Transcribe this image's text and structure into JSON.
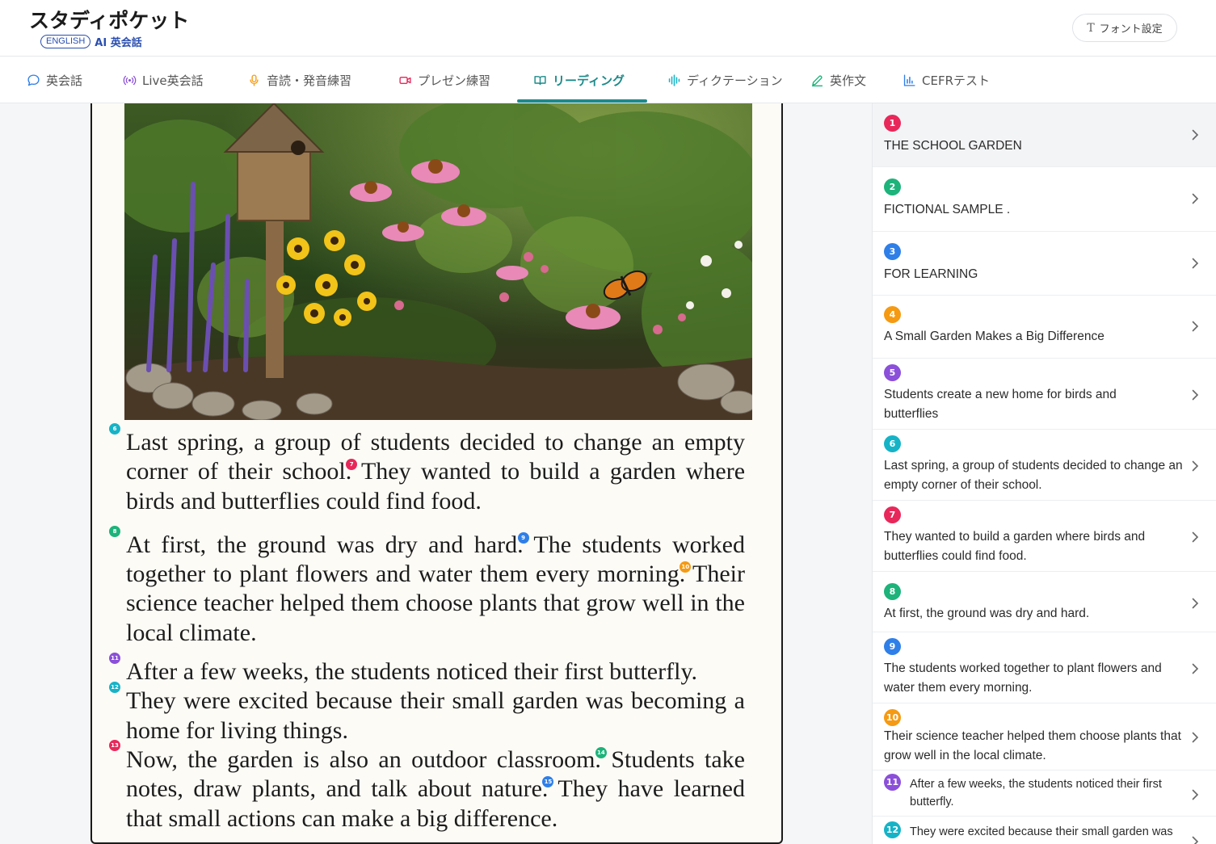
{
  "header": {
    "app_title": "スタディポケット",
    "badge": "ENGLISH",
    "subtitle": "AI 英会話",
    "font_settings": "フォント設定"
  },
  "nav": {
    "tabs": [
      {
        "label": "英会話",
        "icon": "chat-bubble-icon"
      },
      {
        "label": "Live英会話",
        "icon": "broadcast-icon"
      },
      {
        "label": "音読・発音練習",
        "icon": "microphone-icon"
      },
      {
        "label": "プレゼン練習",
        "icon": "video-camera-icon"
      },
      {
        "label": "リーディング",
        "icon": "open-book-icon",
        "active": true
      },
      {
        "label": "ディクテーション",
        "icon": "sound-wave-icon"
      },
      {
        "label": "英作文",
        "icon": "pencil-icon"
      },
      {
        "label": "CEFRテスト",
        "icon": "bar-chart-icon"
      }
    ]
  },
  "article": {
    "image": "garden-photo",
    "sentences": [
      "Last spring, a group of students decided to change an empty corner of their school.",
      "They wanted to build a garden where birds and butterflies could find food.",
      "At first, the ground was dry and hard.",
      "The students worked together to plant flowers and water them every morning.",
      "Their science teacher helped them choose plants that grow well in the local climate.",
      "After a few weeks, the students noticed their first butterfly.",
      "They were excited because their small garden was becoming a home for living things.",
      "Now, the garden is also an outdoor classroom.",
      "Students take notes, draw plants, and talk about nature.",
      "They have learned that small actions can make a big difference."
    ],
    "markers": [
      "6",
      "7",
      "8",
      "9",
      "10",
      "11",
      "12",
      "13",
      "14",
      "15"
    ]
  },
  "sidebar": {
    "items": [
      {
        "num": "1",
        "text": "THE SCHOOL GARDEN",
        "color": "#e8285a"
      },
      {
        "num": "2",
        "text": "FICTIONAL SAMPLE .",
        "color": "#1db37a"
      },
      {
        "num": "3",
        "text": "FOR LEARNING",
        "color": "#2f7fe8"
      },
      {
        "num": "4",
        "text": "A Small Garden Makes a Big Difference",
        "color": "#f59a12"
      },
      {
        "num": "5",
        "text": "Students create a new home for birds and butterflies",
        "color": "#8b4fd9"
      },
      {
        "num": "6",
        "text": "Last spring, a group of students decided to change an empty corner of their school.",
        "color": "#16b3c7"
      },
      {
        "num": "7",
        "text": "They wanted to build a garden where birds and butterflies could find food.",
        "color": "#e8285a"
      },
      {
        "num": "8",
        "text": "At first, the ground was dry and hard.",
        "color": "#1db37a"
      },
      {
        "num": "9",
        "text": "The students worked together to plant flowers and water them every morning.",
        "color": "#2f7fe8"
      },
      {
        "num": "10",
        "text": "Their science teacher helped them choose plants that grow well in the local climate.",
        "color": "#f59a12"
      },
      {
        "num": "11",
        "text": "After a few weeks, the students noticed their first butterfly.",
        "color": "#8b4fd9"
      },
      {
        "num": "12",
        "text": "They were excited because their small garden was becoming",
        "color": "#16b3c7"
      }
    ]
  }
}
